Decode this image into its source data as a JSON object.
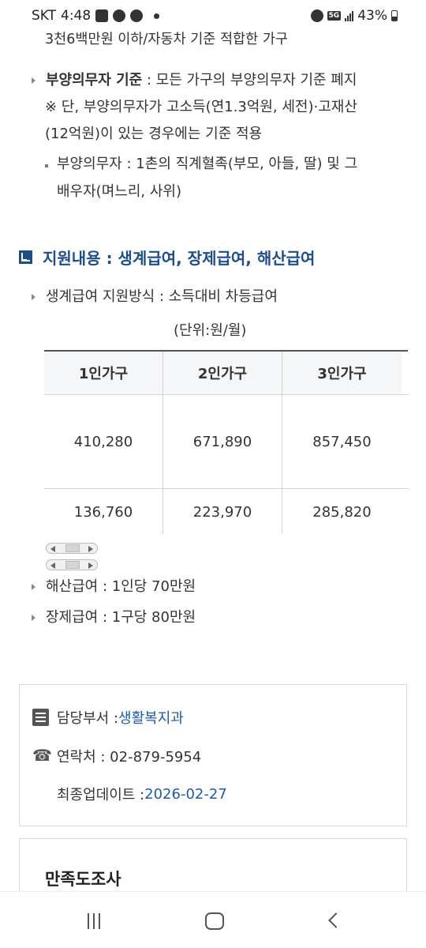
{
  "status_bar": {
    "carrier": "SKT",
    "time": "4:48",
    "network": "5G",
    "battery": "43%"
  },
  "criteria": {
    "top_line": "3천6백만원 이하/자동차 기준 적합한 가구",
    "dependent_label": "부양의무자 기준",
    "dependent_text": " : 모든 가구의 부양의무자 기준 폐지",
    "note_line1": "※ 단, 부양의무자가 고소득(연1.3억원, 세전)·고재산",
    "note_line2": "(12억원)이 있는 경우에는 기준 적용",
    "sub_line1": "부양의무자 : 1촌의 직계혈족(부모, 아들, 딸) 및 그",
    "sub_line2": "배우자(며느리, 사위)"
  },
  "support": {
    "title": "지원내용 : 생계급여, 장제급여, 해산급여",
    "method": "생계급여 지원방식 : 소득대비 차등급여",
    "unit": "(단위:원/월)"
  },
  "table": {
    "headers": [
      "1인가구",
      "2인가구",
      "3인가구"
    ],
    "rows": [
      [
        "410,280",
        "671,890",
        "857,450"
      ],
      [
        "136,760",
        "223,970",
        "285,820"
      ]
    ]
  },
  "benefits": {
    "birth": "해산급여 : 1인당 70만원",
    "funeral": "장제급여 : 1구당 80만원"
  },
  "info": {
    "dept_label": "담당부서 : ",
    "dept_value": "생활복지과",
    "contact_label": "연락처 : 02-879-5954",
    "update_label": "최종업데이트 : ",
    "update_value": "2026-02-27"
  },
  "survey": {
    "title": "만족도조사"
  }
}
